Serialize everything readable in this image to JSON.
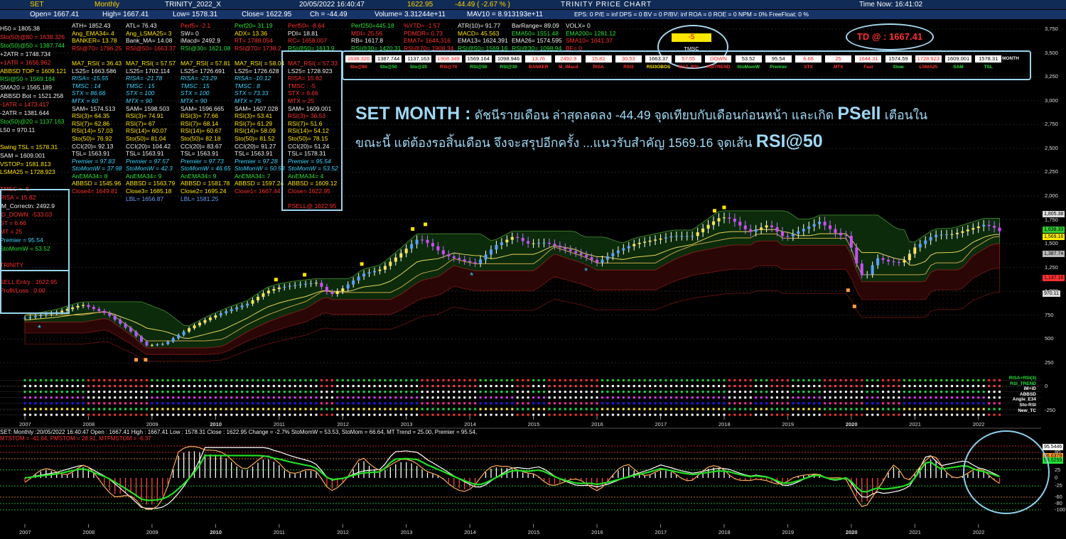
{
  "topbar1": {
    "symbol": "SET",
    "period": "Monthly",
    "system": "TRINITY_2022_X",
    "datetime": "20/05/2022 16:40:47",
    "last": "1622.95",
    "change": "-44.49 ( -2.67 % )",
    "chart_title": "TRINITY PRICE CHART",
    "time_now": "Time Now: 16:41:02"
  },
  "topbar2": {
    "open": "Open= 1667.41",
    "high": "High= 1667.41",
    "low": "Low= 1578.31",
    "close": "Close= 1622.95",
    "ch": "Ch = -44.49",
    "volume": "Volume= 3.31244e+11",
    "mav10": "MAV10 = 8.913193e+11",
    "fund": "EPS: 0    P/E = inf    DPS = 0    BV = 0    P/BV: inf    ROA = 0    ROE = 0    NPM = 0%    FreeFloat: 0 %"
  },
  "left_panel": [
    {
      "t": "H50 = 1805.38",
      "c": "w"
    },
    {
      "t": "Sto(50)@80 = 1638.326",
      "c": "r"
    },
    {
      "t": "Sto(50)@50 = 1387.744",
      "c": "g"
    },
    {
      "t": "+2ATR = 1748.734",
      "c": "w"
    },
    {
      "t": "+1ATR = 1656.962",
      "c": "r"
    },
    {
      "t": "ABBSD TOP = 1609.121",
      "c": "y"
    },
    {
      "t": "RSI@50 = 1569.164",
      "c": "g"
    },
    {
      "t": "SMA20 = 1565.189",
      "c": "w"
    },
    {
      "t": "ABBSD Bot = 1521.258",
      "c": "w"
    },
    {
      "t": "-1ATR = 1473.417",
      "c": "r"
    },
    {
      "t": "-2ATR = 1381.644",
      "c": "w"
    },
    {
      "t": "Sto(50)@20 = 1137.163",
      "c": "g"
    },
    {
      "t": "L50 = 970.11",
      "c": "w"
    },
    {
      "t": "",
      "c": "w"
    },
    {
      "t": "Swing TSL = 1578.31",
      "c": "y"
    },
    {
      "t": "SAM = 1609.001",
      "c": "w"
    },
    {
      "t": "VSTOP= 1581.813",
      "c": "y"
    },
    {
      "t": "LSMA25 = 1728.923",
      "c": "y"
    },
    {
      "t": "",
      "c": "w"
    },
    {
      "t": "TMSC = -5",
      "c": "r"
    },
    {
      "t": "RISA = 15.82",
      "c": "r"
    },
    {
      "t": "iM_Correctn: 2492.9",
      "c": "w"
    },
    {
      "t": "iD_DOWN: -533.03",
      "c": "r"
    },
    {
      "t": "ST = 6.66",
      "c": "r"
    },
    {
      "t": "MT = 25",
      "c": "r"
    },
    {
      "t": "Premier = 95.54",
      "c": "c"
    },
    {
      "t": "StoMomW = 53.52",
      "c": "g"
    },
    {
      "t": "",
      "c": "w"
    },
    {
      "t": "TRINITY",
      "c": "r"
    },
    {
      "t": "",
      "c": "w"
    },
    {
      "t": "SELL Entry  : 1622.95",
      "c": "r"
    },
    {
      "t": "Profit/Loss  : 0.00",
      "c": "r"
    }
  ],
  "col1": [
    {
      "t": "ATH= 1852.43",
      "c": "w"
    },
    {
      "t": "Ang_EMA34= 4",
      "c": "y"
    },
    {
      "t": "BANKER= 13.78",
      "c": "y"
    },
    {
      "t": "RSI@70= 1786.25",
      "c": "r"
    },
    {
      "t": "",
      "c": "w"
    },
    {
      "t": "MA7_RSI( = 36.43",
      "c": "y"
    },
    {
      "t": "LS25= 1663.586",
      "c": "w"
    },
    {
      "t": "RISA= -15.55",
      "c": "c"
    },
    {
      "t": "TMSC : 14",
      "c": "c"
    },
    {
      "t": "STX = 86.66",
      "c": "c"
    },
    {
      "t": "MTX = 60",
      "c": "c"
    },
    {
      "t": "SAM= 1574.513",
      "c": "w"
    },
    {
      "t": "RSI(3)= 64.35",
      "c": "y"
    },
    {
      "t": "RSI(7)= 62.86",
      "c": "y"
    },
    {
      "t": "RSI(14)= 57.03",
      "c": "y"
    },
    {
      "t": "Sto(50)= 76.92",
      "c": "y"
    },
    {
      "t": "CCI(20)= 92.13",
      "c": "w"
    },
    {
      "t": "TSL= 1563.91",
      "c": "w"
    },
    {
      "t": "Premier = 97.83",
      "c": "c"
    },
    {
      "t": "StoMomW = 37.98",
      "c": "c"
    },
    {
      "t": "AnEMA34= 8",
      "c": "g"
    },
    {
      "t": "ABBSD = 1545.96",
      "c": "y"
    },
    {
      "t": "Close4= 1649.81",
      "c": "r"
    }
  ],
  "col2": [
    {
      "t": "ATL= 76.43",
      "c": "w"
    },
    {
      "t": "Ang_LSMA25= 3",
      "c": "y"
    },
    {
      "t": "Bank_MA= 14.08",
      "c": "w"
    },
    {
      "t": "RSI@50= 1663.37",
      "c": "r"
    },
    {
      "t": "",
      "c": "w"
    },
    {
      "t": "MA7_RSI( = 57.57",
      "c": "y"
    },
    {
      "t": "LS25= 1702.114",
      "c": "w"
    },
    {
      "t": "RISA= -21.78",
      "c": "c"
    },
    {
      "t": "TMSC : 15",
      "c": "c"
    },
    {
      "t": "STX = 100",
      "c": "c"
    },
    {
      "t": "MTX = 90",
      "c": "c"
    },
    {
      "t": "SAM= 1598.503",
      "c": "w"
    },
    {
      "t": "RSI(3)= 74.91",
      "c": "y"
    },
    {
      "t": "RSI(7)= 67",
      "c": "y"
    },
    {
      "t": "RSI(14)= 60.07",
      "c": "y"
    },
    {
      "t": "Sto(50)= 81.04",
      "c": "y"
    },
    {
      "t": "CCI(20)= 104.42",
      "c": "w"
    },
    {
      "t": "TSL= 1563.91",
      "c": "w"
    },
    {
      "t": "Premier = 97.57",
      "c": "c"
    },
    {
      "t": "StoMomW = 42.3",
      "c": "c"
    },
    {
      "t": "AnEMA34= 9",
      "c": "g"
    },
    {
      "t": "ABBSD = 1563.79",
      "c": "y"
    },
    {
      "t": "Close3= 1685.18",
      "c": "y"
    },
    {
      "t": "LBL= 1656.87",
      "c": "b"
    }
  ],
  "col3": [
    {
      "t": "Perf5= -2.1",
      "c": "r"
    },
    {
      "t": "SW= 0",
      "c": "w"
    },
    {
      "t": "iMacd= 2492.9",
      "c": "w"
    },
    {
      "t": "RSI@30= 1621.08",
      "c": "g"
    },
    {
      "t": "",
      "c": "w"
    },
    {
      "t": "MA7_RSI( = 57.81",
      "c": "y"
    },
    {
      "t": "LS25= 1726.691",
      "c": "w"
    },
    {
      "t": "RISA= -23.29",
      "c": "c"
    },
    {
      "t": "TMSC : 15",
      "c": "c"
    },
    {
      "t": "STX = 100",
      "c": "c"
    },
    {
      "t": "MTX = 90",
      "c": "c"
    },
    {
      "t": "SAM= 1596.665",
      "c": "w"
    },
    {
      "t": "RSI(3)= 77.66",
      "c": "y"
    },
    {
      "t": "RSI(7)= 68.14",
      "c": "y"
    },
    {
      "t": "RSI(14)= 60.67",
      "c": "y"
    },
    {
      "t": "Sto(50)= 82.18",
      "c": "y"
    },
    {
      "t": "CCI(20)= 83.67",
      "c": "w"
    },
    {
      "t": "TSL= 1563.91",
      "c": "w"
    },
    {
      "t": "Premier = 97.73",
      "c": "c"
    },
    {
      "t": "StoMomW = 46.65",
      "c": "c"
    },
    {
      "t": "AnEMA34= 9",
      "c": "g"
    },
    {
      "t": "ABBSD = 1581.78",
      "c": "y"
    },
    {
      "t": "Close2= 1695.24",
      "c": "y"
    },
    {
      "t": "LBL= 1581.25",
      "c": "b"
    }
  ],
  "col4": [
    {
      "t": "Perf20= 31.19",
      "c": "g"
    },
    {
      "t": "ADX= 13.36",
      "c": "y"
    },
    {
      "t": "RT= 1788.054",
      "c": "r"
    },
    {
      "t": "RSI@70= 1738.2",
      "c": "r"
    },
    {
      "t": "",
      "c": "w"
    },
    {
      "t": "MA7_RSI( = 58.04",
      "c": "y"
    },
    {
      "t": "LS25= 1726.628",
      "c": "w"
    },
    {
      "t": "RISA= -10.12",
      "c": "c"
    },
    {
      "t": "TMSC : 8",
      "c": "c"
    },
    {
      "t": "STX = 73.33",
      "c": "c"
    },
    {
      "t": "MTX = 75",
      "c": "c"
    },
    {
      "t": "SAM= 1607.028",
      "c": "w"
    },
    {
      "t": "RSI(3)= 53.41",
      "c": "y"
    },
    {
      "t": "RSI(7)= 61.29",
      "c": "y"
    },
    {
      "t": "RSI(14)= 58.09",
      "c": "y"
    },
    {
      "t": "Sto(50)= 81.52",
      "c": "y"
    },
    {
      "t": "CCI(20)= 91.27",
      "c": "w"
    },
    {
      "t": "TSL= 1563.91",
      "c": "w"
    },
    {
      "t": "Premier = 97.28",
      "c": "c"
    },
    {
      "t": "StoMomW = 50.53",
      "c": "c"
    },
    {
      "t": "AnEMA34= 7",
      "c": "g"
    },
    {
      "t": "ABBSD = 1597.24",
      "c": "y"
    },
    {
      "t": "Close1= 1667.44",
      "c": "r"
    }
  ],
  "col5": [
    {
      "t": "Perf50= -8.64",
      "c": "r"
    },
    {
      "t": "PDI= 18.81",
      "c": "w"
    },
    {
      "t": "RC= 1658.007",
      "c": "r"
    },
    {
      "t": "RSI@50= 1613.9",
      "c": "g"
    },
    {
      "t": "",
      "c": "w"
    },
    {
      "t": "MA7_RSI( = 57.33",
      "c": "r"
    },
    {
      "t": "LS25= 1728.923",
      "c": "w"
    },
    {
      "t": "RISA= 15.82",
      "c": "r"
    },
    {
      "t": "TMSC : -5",
      "c": "r"
    },
    {
      "t": "STX = 6.66",
      "c": "r"
    },
    {
      "t": "MTX = 25",
      "c": "r"
    },
    {
      "t": "SAM= 1609.001",
      "c": "w"
    },
    {
      "t": "RSI(3)= 30.53",
      "c": "r"
    },
    {
      "t": "RSI(7)= 51.6",
      "c": "y"
    },
    {
      "t": "RSI(14)= 54.12",
      "c": "y"
    },
    {
      "t": "Sto(50)= 78.15",
      "c": "y"
    },
    {
      "t": "CCI(20)= 51.24",
      "c": "w"
    },
    {
      "t": "TSL= 1578.31",
      "c": "w"
    },
    {
      "t": "Premier = 95.54",
      "c": "c"
    },
    {
      "t": "StoMomW = 53.52",
      "c": "c"
    },
    {
      "t": "AnEMA34= 4",
      "c": "g"
    },
    {
      "t": "ABBSD = 1609.12",
      "c": "y"
    },
    {
      "t": "Close= 1622.95",
      "c": "r"
    },
    {
      "t": "",
      "c": "w"
    },
    {
      "t": "PSELL@ 1622.95",
      "c": "r"
    }
  ],
  "col6": [
    {
      "t": "Perf250=445.18",
      "c": "g"
    },
    {
      "t": "MDI= 25.56",
      "c": "r"
    },
    {
      "t": "RB= 1617.8",
      "c": "w"
    },
    {
      "t": "RSI@30= 1420.31",
      "c": "g"
    }
  ],
  "col7": [
    {
      "t": "%YTD= -1.57",
      "c": "r"
    },
    {
      "t": "PDMDR= 0.73",
      "c": "r"
    },
    {
      "t": "EMA7= 1644.316",
      "c": "r"
    },
    {
      "t": "RSI@70= 1908.34",
      "c": "r"
    }
  ],
  "col8": [
    {
      "t": "ATR(10)= 91.77",
      "c": "w"
    },
    {
      "t": "MACD= 45.563",
      "c": "y"
    },
    {
      "t": "EMA13= 1624.391",
      "c": "w"
    },
    {
      "t": "RSI@50= 1569.16",
      "c": "g"
    }
  ],
  "col9": [
    {
      "t": "BarRange= 89.09",
      "c": "w"
    },
    {
      "t": "EMA50= 1551.48",
      "c": "g"
    },
    {
      "t": "EMA26= 1574.595",
      "c": "w"
    },
    {
      "t": "RSI@30= 1098.94",
      "c": "g"
    }
  ],
  "col10": [
    {
      "t": "VOLX= 0",
      "c": "w"
    },
    {
      "t": "EMA200= 1281.12",
      "c": "g"
    },
    {
      "t": "SMA10= 1641.37",
      "c": "r"
    },
    {
      "t": "BF= 0",
      "c": "r"
    }
  ],
  "tmsc": {
    "value": "-5",
    "label": "TMSC"
  },
  "td": "TD @ : 1667.41",
  "indicator_table": {
    "values": [
      {
        "v": "1638.326",
        "red": true
      },
      {
        "v": "1387.744",
        "red": false
      },
      {
        "v": "1137.163",
        "red": false
      },
      {
        "v": "1908.349",
        "red": true
      },
      {
        "v": "1569.164",
        "red": false
      },
      {
        "v": "1098.946",
        "red": false
      },
      {
        "v": "13.76",
        "red": true
      },
      {
        "v": "2492.9",
        "red": true
      },
      {
        "v": "15.82",
        "red": true
      },
      {
        "v": "30.53",
        "red": true
      },
      {
        "v": "1663.37",
        "red": false
      },
      {
        "v": "57.55",
        "red": true
      },
      {
        "v": "DOWN",
        "red": true
      },
      {
        "v": "53.52",
        "red": false
      },
      {
        "v": "95.54",
        "red": false
      },
      {
        "v": "6.66",
        "red": true
      },
      {
        "v": "25",
        "red": true
      },
      {
        "v": "1644.31",
        "red": true
      },
      {
        "v": "1574.59",
        "red": false
      },
      {
        "v": "1728.923",
        "red": true
      },
      {
        "v": "1609.001",
        "red": false
      },
      {
        "v": "1578.31",
        "red": false
      }
    ],
    "labels": [
      {
        "t": "Sto@80",
        "c": "r"
      },
      {
        "t": "Sto@50",
        "c": "g"
      },
      {
        "t": "Sto@20",
        "c": "g"
      },
      {
        "t": "RSI@70",
        "c": "r"
      },
      {
        "t": "RSI@50",
        "c": "g"
      },
      {
        "t": "RSI@30",
        "c": "g"
      },
      {
        "t": "BANKER",
        "c": "r"
      },
      {
        "t": "M_iMacd",
        "c": "r"
      },
      {
        "t": "RISA",
        "c": "r"
      },
      {
        "t": "RSI3",
        "c": "r"
      },
      {
        "t": "RSI3OBOS",
        "c": "y"
      },
      {
        "t": "MA7_RSI",
        "c": "r"
      },
      {
        "t": "RSITREND",
        "c": "r"
      },
      {
        "t": "StoMomW",
        "c": "g"
      },
      {
        "t": "Premier",
        "c": "g"
      },
      {
        "t": "STX",
        "c": "r"
      },
      {
        "t": "MTX",
        "c": "r"
      },
      {
        "t": "Fast",
        "c": "r"
      },
      {
        "t": "Slow",
        "c": "g"
      },
      {
        "t": "LSMA25",
        "c": "r"
      },
      {
        "t": "SAM",
        "c": "g"
      },
      {
        "t": "TSL",
        "c": "g"
      }
    ],
    "period": "MONTH"
  },
  "headline": {
    "title": "SET MONTH :",
    "line1": "ดัชนีรายเดือน ล่าสุดลดลง -44.49 จุดเทียบกับเดือนก่อนหน้า และเกิด",
    "psell": "PSell",
    "line1b": "เตือนใน",
    "line2": "ขณะนี้  แต่ต้องรอสิ้นเดือน จึงจะสรุปอีกครั้ง ...แนวรับสำคัญ 1569.16 จุดเส้น",
    "rsi": "RSI@50"
  },
  "right_axis": {
    "ticks": [
      "3,750",
      "3,500",
      "3,250",
      "3,000",
      "2,750",
      "2,500",
      "2,250",
      "2,000",
      "1,750",
      "1,500",
      "1,250",
      "1,000",
      "750",
      "500",
      "250",
      "0",
      "-250"
    ]
  },
  "price_tags": [
    {
      "t": "1,805.38",
      "c": "#dddddd"
    },
    {
      "t": "1,638.33",
      "c": "#33cc33"
    },
    {
      "t": "1,569.16",
      "c": "#ffee00"
    },
    {
      "t": "1,387.74",
      "c": "#bbbbbb"
    },
    {
      "t": "1,137.16",
      "c": "#ff3030"
    },
    {
      "t": "970.11",
      "c": "#dddddd"
    }
  ],
  "strip_legend": [
    "RISA+RSI(3)",
    "RSI_TREND",
    "iM+iD",
    "ABBSD",
    "Angle_E34",
    "Sto-RSI",
    "New_TC"
  ],
  "years": [
    "2007",
    "2008",
    "2009",
    "2010",
    "2011",
    "2012",
    "2013",
    "2014",
    "2015",
    "2016",
    "2017",
    "2018",
    "2019",
    "2020",
    "2021",
    "2022"
  ],
  "sub_info": {
    "line1": "SET: Monthly :20/05/2022 16:40:47 Open : 1667.41 High : 1667.41 Low : 1578.31 Close : 1622.95 Change = -2.7% StoMomW = 53.53, StoMom = 66.64, MT Trend = 25.00, Premier = 95.54,",
    "line2": "MTSTOM = -41.64,  PMSTOM = 28.91,  MTFMSTOM = -6.37"
  },
  "osc_axis": {
    "ticks": [
      "100",
      "80",
      "60",
      "25",
      "0",
      "-25",
      "-60",
      "-80",
      "-100"
    ],
    "tags": [
      {
        "t": "95.5446",
        "c": "#ffffff"
      },
      {
        "t": "66.6379",
        "c": "#ff9a2e"
      },
      {
        "t": "53.5259",
        "c": "#28e23a"
      }
    ]
  },
  "chart_data": {
    "type": "candlestick",
    "title": "TRINITY PRICE CHART",
    "x_years": [
      "2007",
      "2008",
      "2009",
      "2010",
      "2011",
      "2012",
      "2013",
      "2014",
      "2015",
      "2016",
      "2017",
      "2018",
      "2019",
      "2020",
      "2021",
      "2022"
    ],
    "yaxis_range": [
      -250,
      3750
    ],
    "close_path": [
      [
        2007.0,
        720
      ],
      [
        2007.5,
        780
      ],
      [
        2007.9,
        860
      ],
      [
        2008.3,
        760
      ],
      [
        2008.7,
        560
      ],
      [
        2008.9,
        430
      ],
      [
        2009.2,
        450
      ],
      [
        2009.6,
        620
      ],
      [
        2009.9,
        720
      ],
      [
        2010.2,
        800
      ],
      [
        2010.5,
        870
      ],
      [
        2010.8,
        1000
      ],
      [
        2011.0,
        1040
      ],
      [
        2011.3,
        1070
      ],
      [
        2011.6,
        1090
      ],
      [
        2011.8,
        960
      ],
      [
        2012.0,
        1030
      ],
      [
        2012.3,
        1180
      ],
      [
        2012.6,
        1230
      ],
      [
        2012.9,
        1390
      ],
      [
        2013.2,
        1560
      ],
      [
        2013.4,
        1480
      ],
      [
        2013.6,
        1380
      ],
      [
        2013.9,
        1320
      ],
      [
        2014.1,
        1290
      ],
      [
        2014.4,
        1480
      ],
      [
        2014.7,
        1580
      ],
      [
        2014.9,
        1500
      ],
      [
        2015.2,
        1510
      ],
      [
        2015.5,
        1440
      ],
      [
        2015.8,
        1370
      ],
      [
        2016.0,
        1300
      ],
      [
        2016.3,
        1420
      ],
      [
        2016.6,
        1500
      ],
      [
        2016.9,
        1540
      ],
      [
        2017.2,
        1580
      ],
      [
        2017.5,
        1580
      ],
      [
        2017.8,
        1720
      ],
      [
        2017.95,
        1780
      ],
      [
        2018.1,
        1760
      ],
      [
        2018.4,
        1620
      ],
      [
        2018.7,
        1700
      ],
      [
        2018.95,
        1560
      ],
      [
        2019.2,
        1640
      ],
      [
        2019.5,
        1730
      ],
      [
        2019.8,
        1590
      ],
      [
        2019.95,
        1580
      ],
      [
        2020.05,
        1340
      ],
      [
        2020.2,
        1120
      ],
      [
        2020.4,
        1350
      ],
      [
        2020.6,
        1310
      ],
      [
        2020.8,
        1300
      ],
      [
        2021.0,
        1460
      ],
      [
        2021.3,
        1590
      ],
      [
        2021.6,
        1600
      ],
      [
        2021.9,
        1660
      ],
      [
        2022.1,
        1700
      ],
      [
        2022.25,
        1667
      ],
      [
        2022.35,
        1623
      ]
    ],
    "stop_levels": {
      "H50": 1805.38,
      "L50": 970.11,
      "RSI@50": 1569.164,
      "Sto@80": 1638.326,
      "Sto@50": 1387.744,
      "Sto@20": 1137.163
    },
    "oscillator_range": [
      -100,
      100
    ],
    "oscillator_series": [
      "StoMomW",
      "StoMom",
      "Premier"
    ]
  }
}
